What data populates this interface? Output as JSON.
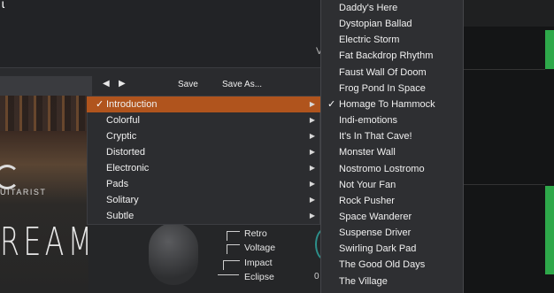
{
  "toolbar": {
    "prev_icon": "◀",
    "next_icon": "▶",
    "save_label": "Save",
    "save_as_label": "Save As..."
  },
  "artwork": {
    "brand_fragment": "UITARIST",
    "title_fragment": "REAM"
  },
  "controls": {
    "rows": [
      "Retro",
      "Voltage",
      "Impact",
      "Eclipse"
    ],
    "readout": "0"
  },
  "category_menu": {
    "items": [
      {
        "label": "Introduction",
        "checked": true,
        "selected": true
      },
      {
        "label": "Colorful",
        "checked": false
      },
      {
        "label": "Cryptic",
        "checked": false
      },
      {
        "label": "Distorted",
        "checked": false
      },
      {
        "label": "Electronic",
        "checked": false
      },
      {
        "label": "Pads",
        "checked": false
      },
      {
        "label": "Solitary",
        "checked": false
      },
      {
        "label": "Subtle",
        "checked": false
      }
    ],
    "check_glyph": "✓",
    "submenu_glyph": "▶"
  },
  "preset_menu": {
    "items": [
      {
        "label": "Daddy's Here",
        "checked": false
      },
      {
        "label": "Dystopian Ballad",
        "checked": false
      },
      {
        "label": "Electric Storm",
        "checked": false
      },
      {
        "label": "Fat Backdrop Rhythm",
        "checked": false
      },
      {
        "label": "Faust Wall Of Doom",
        "checked": false
      },
      {
        "label": "Frog Pond In Space",
        "checked": false
      },
      {
        "label": "Homage To Hammock",
        "checked": true
      },
      {
        "label": "Indi-emotions",
        "checked": false
      },
      {
        "label": "It's In That Cave!",
        "checked": false
      },
      {
        "label": "Monster Wall",
        "checked": false
      },
      {
        "label": "Nostromo Lostromo",
        "checked": false
      },
      {
        "label": "Not Your Fan",
        "checked": false
      },
      {
        "label": "Rock Pusher",
        "checked": false
      },
      {
        "label": "Space Wanderer",
        "checked": false
      },
      {
        "label": "Suspense Driver",
        "checked": false
      },
      {
        "label": "Swirling Dark Pad",
        "checked": false
      },
      {
        "label": "The Good Old Days",
        "checked": false
      },
      {
        "label": "The Village",
        "checked": false
      }
    ],
    "check_glyph": "✓"
  },
  "colors": {
    "selection": "#b0541d",
    "menu_bg": "#2e2f32",
    "accent_green": "#2ea84a"
  }
}
